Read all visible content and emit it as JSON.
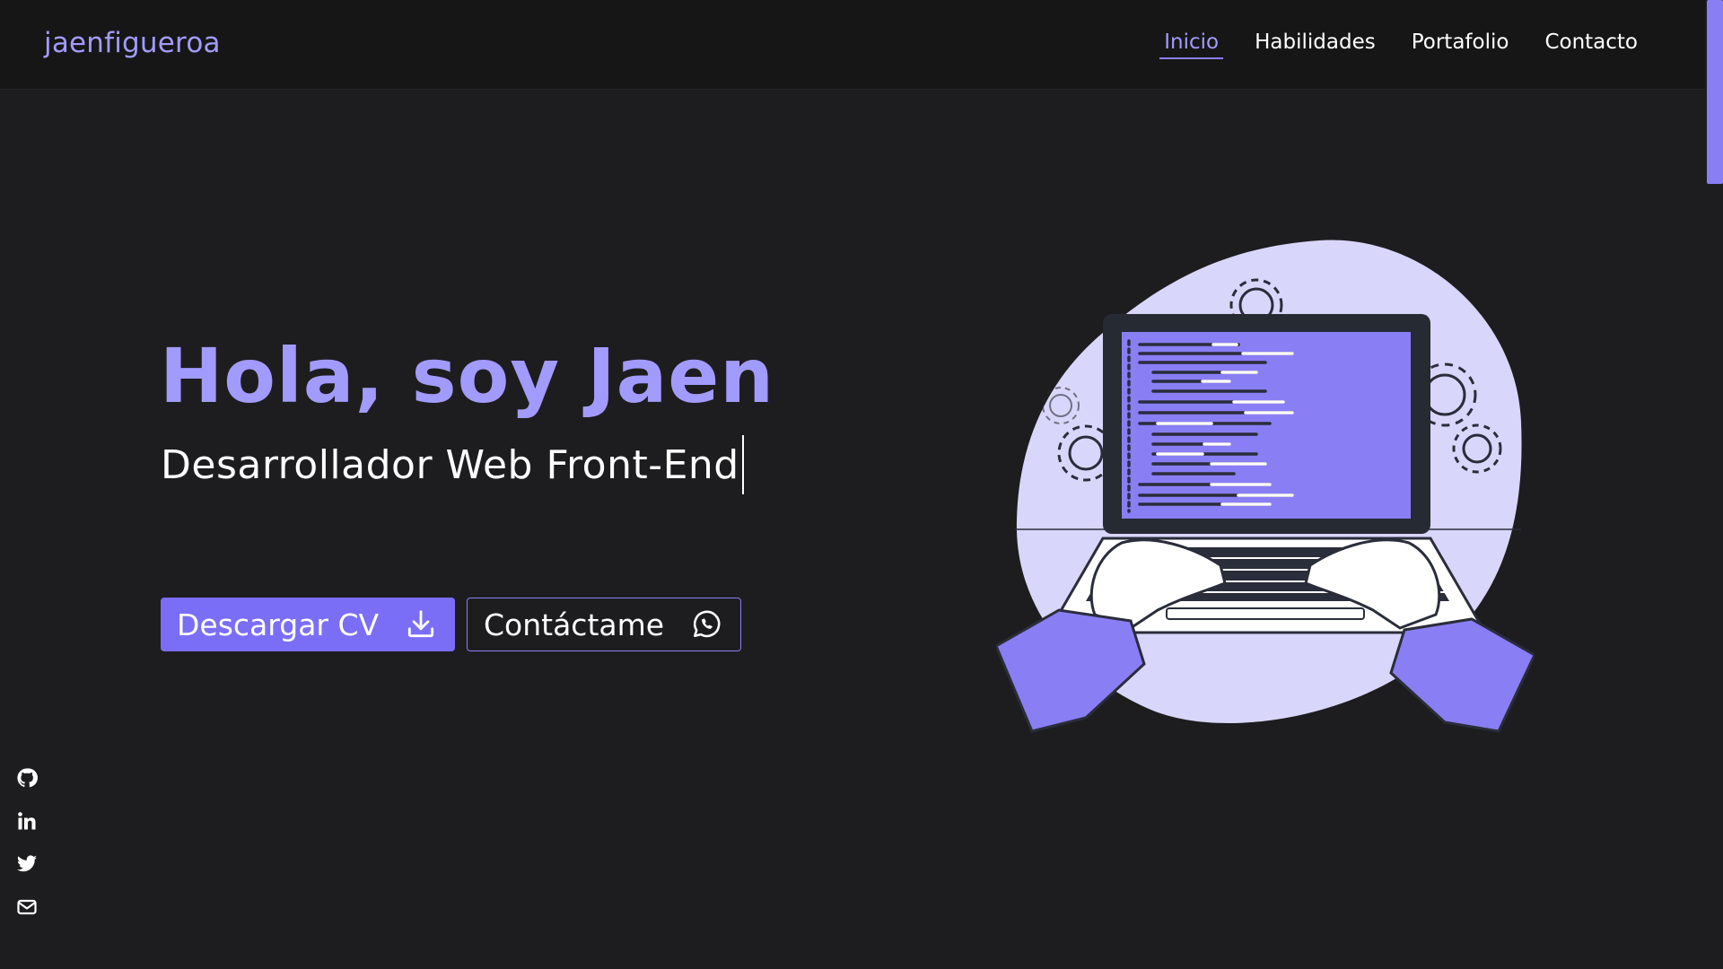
{
  "navbar": {
    "brand": "jaenfigueroa",
    "links": [
      {
        "label": "Inicio",
        "active": true
      },
      {
        "label": "Habilidades",
        "active": false
      },
      {
        "label": "Portafolio",
        "active": false
      },
      {
        "label": "Contacto",
        "active": false
      }
    ]
  },
  "hero": {
    "title": "Hola, soy Jaen",
    "subtitle": "Desarrollador Web Front-End",
    "buttons": {
      "download_cv": {
        "label": "Descargar CV",
        "icon": "download-icon"
      },
      "contact": {
        "label": "Contáctame",
        "icon": "whatsapp-icon"
      }
    }
  },
  "social": [
    {
      "name": "github",
      "icon": "github-icon"
    },
    {
      "name": "linkedin",
      "icon": "linkedin-icon"
    },
    {
      "name": "twitter",
      "icon": "twitter-icon"
    },
    {
      "name": "email",
      "icon": "mail-icon"
    }
  ],
  "colors": {
    "accent": "#a29bfe",
    "primary_button": "#7b6ef6",
    "background": "#1d1d1f",
    "navbar": "#161616"
  }
}
